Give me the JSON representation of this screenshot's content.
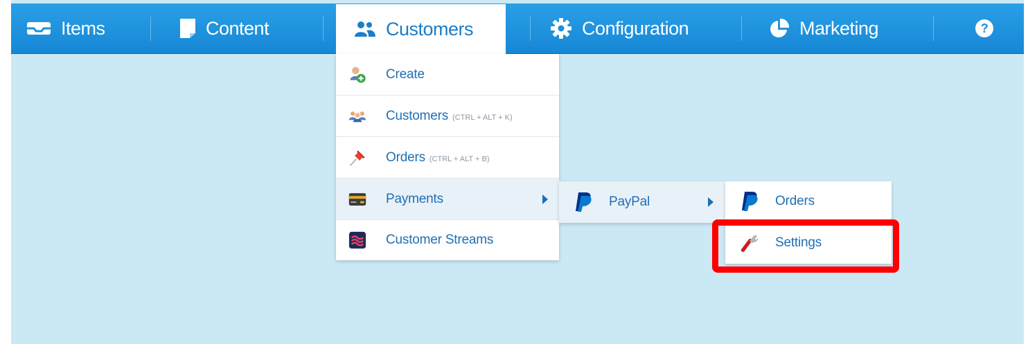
{
  "nav": {
    "items": {
      "label": "Items",
      "icon": "inbox-icon"
    },
    "content": {
      "label": "Content",
      "icon": "document-icon"
    },
    "customers": {
      "label": "Customers",
      "icon": "users-icon"
    },
    "configuration": {
      "label": "Configuration",
      "icon": "gear-icon"
    },
    "marketing": {
      "label": "Marketing",
      "icon": "pie-chart-icon"
    },
    "help": {
      "icon": "help-icon"
    }
  },
  "customers_menu": [
    {
      "label": "Create",
      "shortcut": "",
      "icon": "add-user-icon"
    },
    {
      "label": "Customers",
      "shortcut": "(CTRL + ALT + K)",
      "icon": "customers-icon"
    },
    {
      "label": "Orders",
      "shortcut": "(CTRL + ALT + B)",
      "icon": "pin-icon"
    },
    {
      "label": "Payments",
      "shortcut": "",
      "icon": "credit-card-icon"
    },
    {
      "label": "Customer Streams",
      "shortcut": "",
      "icon": "streams-icon"
    }
  ],
  "payments_menu": [
    {
      "label": "PayPal",
      "icon": "paypal-icon"
    }
  ],
  "paypal_menu": [
    {
      "label": "Orders",
      "icon": "paypal-icon"
    },
    {
      "label": "Settings",
      "icon": "wrench-icon"
    }
  ],
  "colors": {
    "nav_blue": "#1a8fdd",
    "menu_text": "#1f6fb5",
    "background": "#cbe9f5",
    "highlight_box": "#ff0000"
  }
}
